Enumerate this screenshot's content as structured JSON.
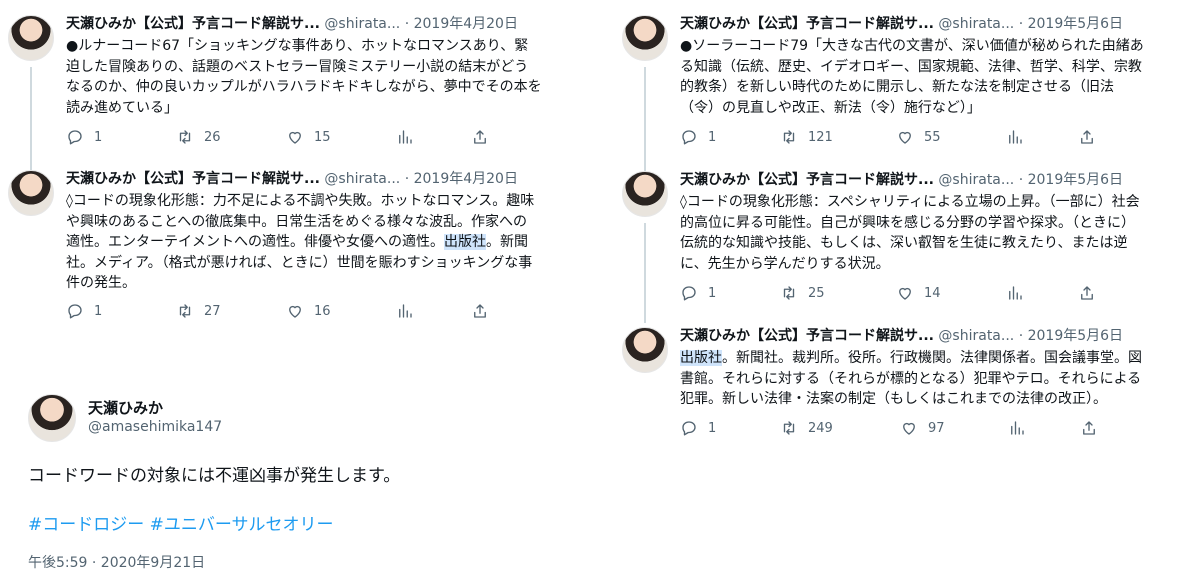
{
  "left_tweets": [
    {
      "name": "天瀬ひみか【公式】予言コード解説サ...",
      "handle": "@shirata...",
      "sep": "·",
      "date": "2019年4月20日",
      "lines": [
        "●ルナーコード67「ショッキングな事件あり、ホットなロマンスあり、緊",
        "迫した冒険ありの、話題のベストセラー冒険ミステリー小説の結末がどう",
        "なるのか、仲の良いカップルがハラハラドキドキしながら、夢中でその本を",
        "読み進めている」"
      ],
      "reply": "1",
      "retweet": "26",
      "like": "15"
    },
    {
      "name": "天瀬ひみか【公式】予言コード解説サ...",
      "handle": "@shirata...",
      "sep": "·",
      "date": "2019年4月20日",
      "lines": [
        "◊コードの現象化形態：力不足による不調や失敗。ホットなロマンス。趣味",
        "や興味のあることへの徹底集中。日常生活をめぐる様々な波乱。作家への",
        "適性。エンターテイメントへの適性。俳優や女優への適性。",
        "社。メディア。（格式が悪ければ、ときに）世間を賑わすショッキングな事",
        "件の発生。"
      ],
      "hl_before": "適性。エンターテイメントへの適性。俳優や女優への適性。",
      "hl": "出版社",
      "hl_after": "。新聞",
      "reply": "1",
      "retweet": "27",
      "like": "16"
    }
  ],
  "right_tweets": [
    {
      "name": "天瀬ひみか【公式】予言コード解説サ...",
      "handle": "@shirata...",
      "sep": "·",
      "date": "2019年5月6日",
      "lines": [
        "●ソーラーコード79「大きな古代の文書が、深い価値が秘められた由緒あ",
        "る知識（伝統、歴史、イデオロギー、国家規範、法律、哲学、科学、宗教",
        "的教条）を新しい時代のために開示し、新たな法を制定させる（旧法",
        "（令）の見直しや改正、新法（令）施行など）」"
      ],
      "reply": "1",
      "retweet": "121",
      "like": "55"
    },
    {
      "name": "天瀬ひみか【公式】予言コード解説サ...",
      "handle": "@shirata...",
      "sep": "·",
      "date": "2019年5月6日",
      "lines": [
        "◊コードの現象化形態：スペシャリティによる立場の上昇。（一部に）社会",
        "的高位に昇る可能性。自己が興味を感じる分野の学習や探求。（ときに）",
        "伝統的な知識や技能、もしくは、深い叡智を生徒に教えたり、または逆",
        "に、先生から学んだりする状況。"
      ],
      "reply": "1",
      "retweet": "25",
      "like": "14"
    },
    {
      "name": "天瀬ひみか【公式】予言コード解説サ...",
      "handle": "@shirata...",
      "sep": "·",
      "date": "2019年5月6日",
      "hl": "出版社",
      "hl_after": "。新聞社。裁判所。役所。行政機関。法律関係者。国会議事堂。図",
      "lines": [
        "書館。それらに対する（それらが標的となる）犯罪やテロ。それらによる",
        "犯罪。新しい法律・法案の制定（もしくはこれまでの法律の改正）。"
      ],
      "reply": "1",
      "retweet": "249",
      "like": "97"
    }
  ],
  "main_tweet": {
    "name": "天瀬ひみか",
    "handle": "@amasehimika147",
    "text": "コードワードの対象には不運凶事が発生します。",
    "hashtags": "#コードロジー #ユニバーサルセオリー",
    "timestamp": "午後5:59 · 2020年9月21日"
  },
  "icons": [
    "reply-icon",
    "retweet-icon",
    "like-icon",
    "analytics-icon",
    "share-icon"
  ],
  "colors": {
    "highlight": "#cfe4fb",
    "link": "#1d9bf0",
    "muted": "#536471"
  }
}
